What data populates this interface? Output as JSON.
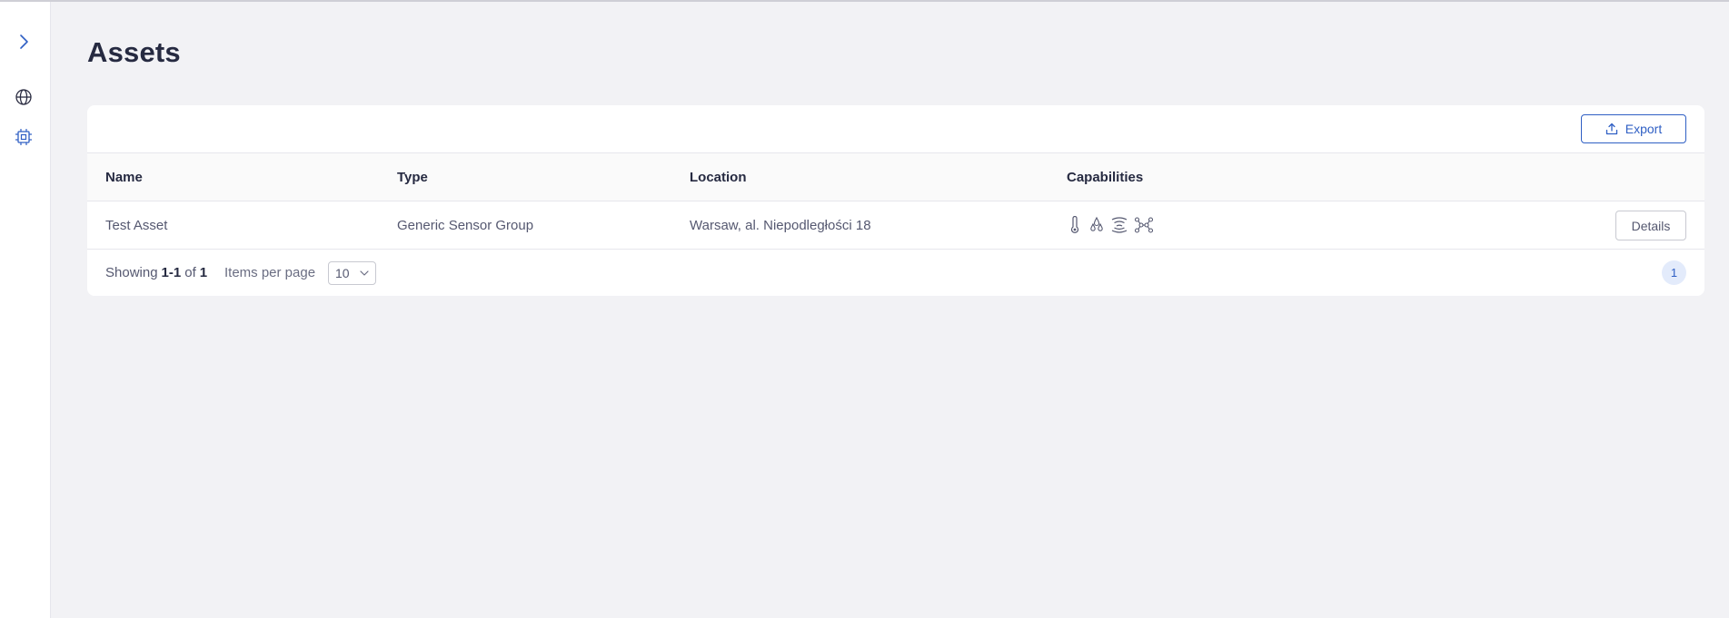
{
  "page": {
    "title": "Assets"
  },
  "sidebar": {
    "items": [
      {
        "name": "expand",
        "icon": "chevron-right-icon"
      },
      {
        "name": "map",
        "icon": "globe-icon"
      },
      {
        "name": "assets",
        "icon": "chip-icon",
        "active": true
      }
    ]
  },
  "toolbar": {
    "export_label": "Export",
    "export_icon": "upload-icon"
  },
  "table": {
    "columns": [
      "Name",
      "Type",
      "Location",
      "Capabilities"
    ],
    "rows": [
      {
        "name": "Test Asset",
        "type": "Generic Sensor Group",
        "location": "Warsaw, al. Niepodległości 18",
        "capabilities": [
          "thermometer-icon",
          "humidity-drops-icon",
          "wireless-signal-icon",
          "molecule-icon"
        ],
        "action_label": "Details"
      }
    ]
  },
  "pagination": {
    "showing_prefix": "Showing",
    "range": "1-1",
    "of_label": "of",
    "total": "1",
    "items_per_page_label": "Items per page",
    "items_per_page_value": "10",
    "current_page": "1"
  },
  "colors": {
    "accent": "#2f5fc4",
    "background": "#f2f2f5",
    "text": "#262a41"
  }
}
